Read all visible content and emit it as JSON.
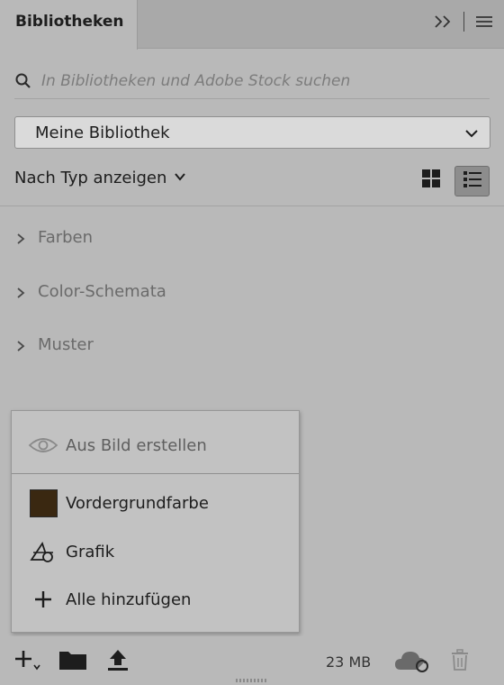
{
  "tab": {
    "title": "Bibliotheken"
  },
  "search": {
    "placeholder": "In Bibliotheken und Adobe Stock suchen"
  },
  "library_select": {
    "value": "Meine Bibliothek"
  },
  "view": {
    "filter_label": "Nach Typ anzeigen",
    "active_mode": "list"
  },
  "sections": [
    {
      "label": "Farben"
    },
    {
      "label": "Color-Schemata"
    },
    {
      "label": "Muster"
    }
  ],
  "popup_menu": {
    "items": [
      {
        "label": "Aus Bild erstellen",
        "icon": "eye-icon",
        "enabled": false
      },
      {
        "label": "Vordergrundfarbe",
        "icon": "color-swatch",
        "swatch_color": "#3a2811",
        "enabled": true
      },
      {
        "label": "Grafik",
        "icon": "graphic-shapes-icon",
        "enabled": true
      },
      {
        "label": "Alle hinzufügen",
        "icon": "plus-icon",
        "enabled": true
      }
    ]
  },
  "bottom_bar": {
    "storage_used": "23 MB"
  },
  "colors": {
    "panel_bg": "#b9b9b9",
    "tabbar_bg": "#a9a9a9",
    "popup_bg": "#c2c2c2",
    "active_toggle_bg": "#8d8d8d"
  }
}
